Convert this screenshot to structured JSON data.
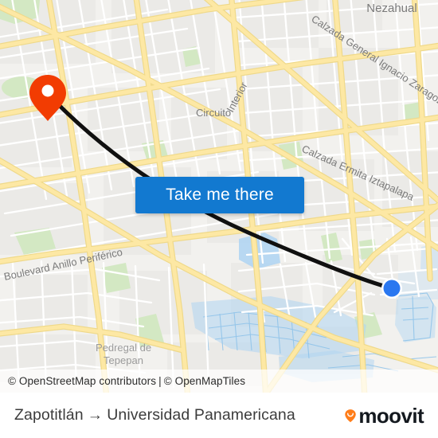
{
  "map": {
    "type": "street-map",
    "provider_attribution": {
      "osm": "© OpenStreetMap contributors",
      "separator": "|",
      "tiles": "© OpenMapTiles"
    },
    "labels": [
      {
        "name": "nezahualcoyotl",
        "text": "Nezahual"
      },
      {
        "name": "calzada-zaragoza",
        "text": "Calzada General Ignacio Zaragoza"
      },
      {
        "name": "circuito",
        "text": "Circuito"
      },
      {
        "name": "interior",
        "text": "Interior"
      },
      {
        "name": "calzada-ermita",
        "text": "Calzada Ermita Iztapalapa"
      },
      {
        "name": "anillo-periferico",
        "text": "Boulevard Anillo Periférico"
      },
      {
        "name": "pedregal-line1",
        "text": "Pedregal de"
      },
      {
        "name": "pedregal-line2",
        "text": "Tepepan"
      }
    ],
    "origin_marker": {
      "name": "origin-pin",
      "color": "#f23c02"
    },
    "destination_marker": {
      "name": "destination-dot",
      "color": "#2a77f0"
    },
    "route_line": {
      "color": "#101010",
      "width": 5
    },
    "colors": {
      "land": "#f2f1ee",
      "block": "#ececea",
      "road_major": "#fbe08c",
      "road_minor": "#ffffff",
      "park": "#d4e8c4",
      "water": "#a9d3f0"
    }
  },
  "cta": {
    "label": "Take me there",
    "background": "#1279d0",
    "text_color": "#ffffff"
  },
  "footer": {
    "origin": "Zapotitlán",
    "arrow": "→",
    "destination": "Universidad Panamericana",
    "brand": "moovit",
    "brand_pin_color": "#ff7d19",
    "brand_text_color": "#14191f"
  }
}
